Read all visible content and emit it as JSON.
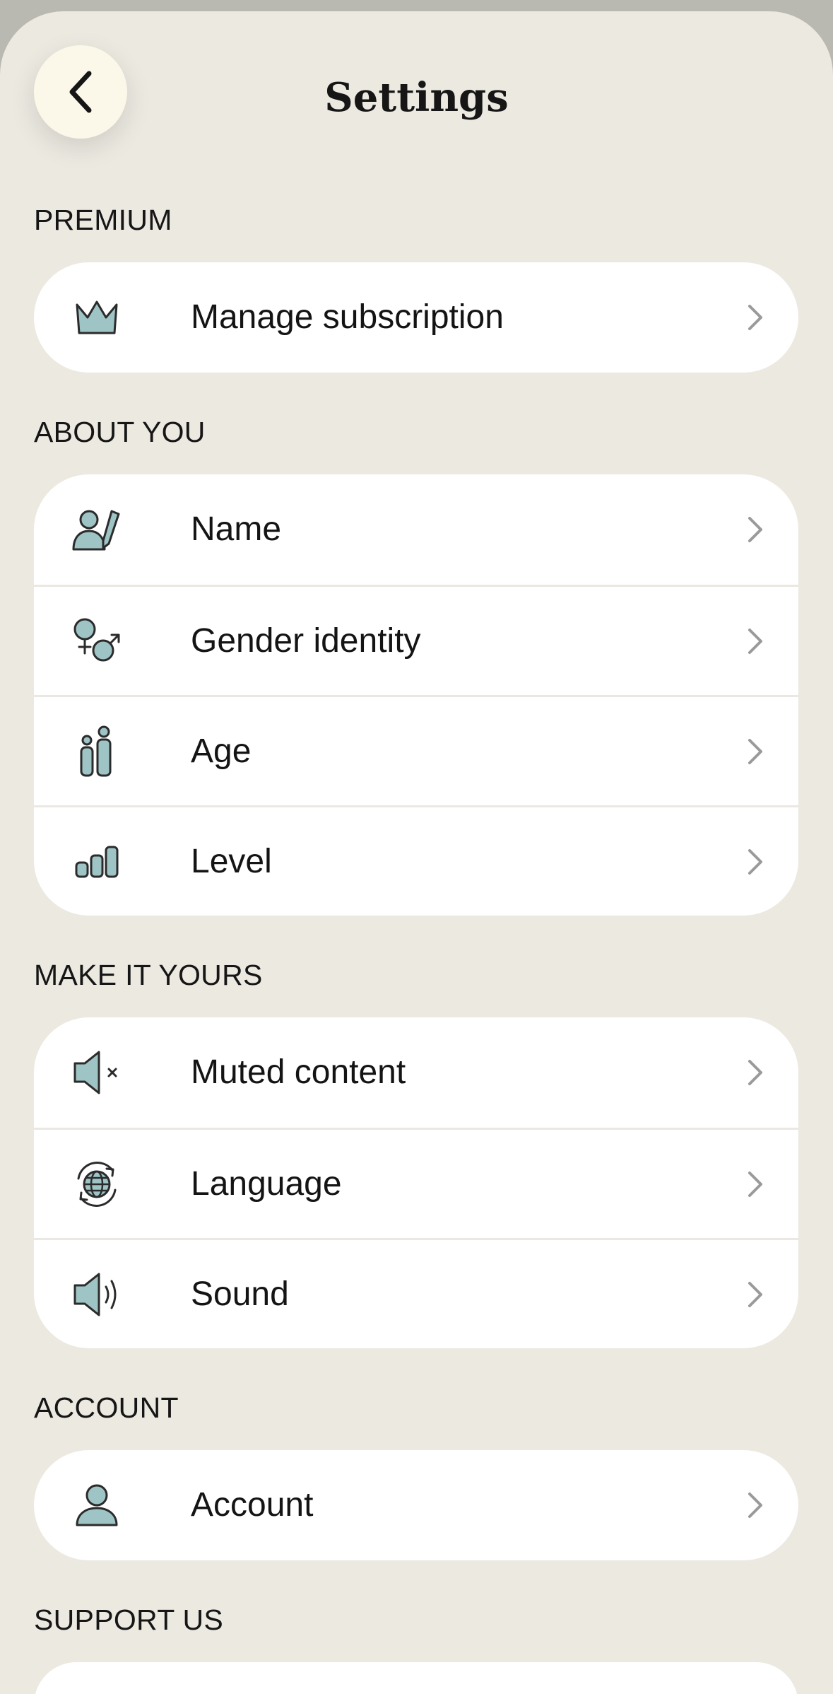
{
  "header": {
    "title": "Settings",
    "back_icon": "chevron-left-icon"
  },
  "sections": [
    {
      "label": "PREMIUM",
      "items": [
        {
          "label": "Manage subscription",
          "icon": "crown-icon"
        }
      ]
    },
    {
      "label": "ABOUT YOU",
      "items": [
        {
          "label": "Name",
          "icon": "person-edit-icon"
        },
        {
          "label": "Gender identity",
          "icon": "gender-icon"
        },
        {
          "label": "Age",
          "icon": "people-icon"
        },
        {
          "label": "Level",
          "icon": "bar-chart-icon"
        }
      ]
    },
    {
      "label": "MAKE IT YOURS",
      "items": [
        {
          "label": "Muted content",
          "icon": "speaker-muted-icon"
        },
        {
          "label": "Language",
          "icon": "globe-icon"
        },
        {
          "label": "Sound",
          "icon": "speaker-icon"
        }
      ]
    },
    {
      "label": "ACCOUNT",
      "items": [
        {
          "label": "Account",
          "icon": "person-icon"
        }
      ]
    },
    {
      "label": "SUPPORT US",
      "items": []
    }
  ],
  "colors": {
    "background": "#ece9e1",
    "card": "#ffffff",
    "icon_fill": "#9fc4c5",
    "icon_stroke": "#2b2b2b",
    "chevron": "#9a9a9a",
    "back_button": "#fbf8ea"
  }
}
